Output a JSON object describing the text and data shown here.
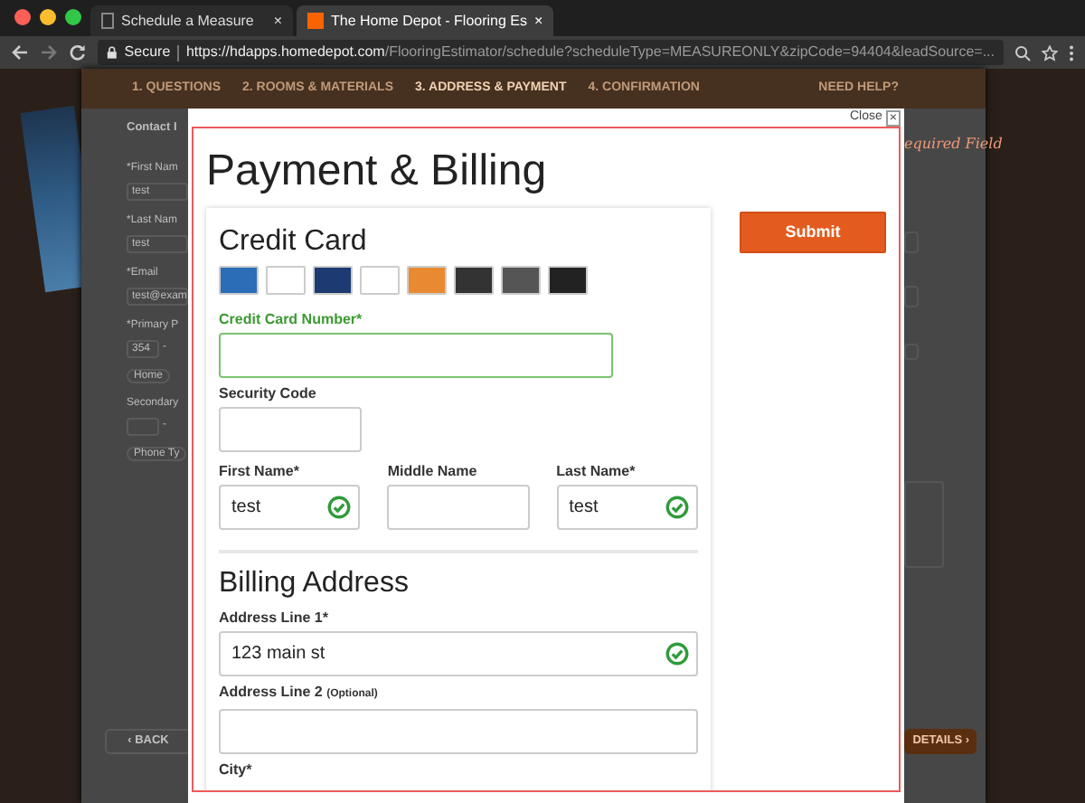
{
  "browser": {
    "tabs": [
      {
        "title": "Schedule a Measure",
        "selected": false
      },
      {
        "title": "The Home Depot - Flooring Es",
        "selected": true
      }
    ],
    "close_glyph": "×",
    "address": {
      "secure": "Secure",
      "host": "https://hdapps.homedepot.com",
      "path": "/FlooringEstimator/schedule?scheduleType=MEASUREONLY&zipCode=94404&leadSource=..."
    }
  },
  "page": {
    "steps": [
      {
        "label": "1. QUESTIONS",
        "selected": false
      },
      {
        "label": "2. ROOMS & MATERIALS",
        "selected": false
      },
      {
        "label": "3. ADDRESS & PAYMENT",
        "selected": true
      },
      {
        "label": "4. CONFIRMATION",
        "selected": false
      }
    ],
    "help": "NEED HELP?",
    "contact_title": "Contact I",
    "contact_items": [
      {
        "kind": "label",
        "text": "*First Nam"
      },
      {
        "kind": "input",
        "text": "test"
      },
      {
        "kind": "label",
        "text": "*Last Nam"
      },
      {
        "kind": "input",
        "text": "test"
      },
      {
        "kind": "label",
        "text": "*Email"
      },
      {
        "kind": "input",
        "text": "test@exam"
      },
      {
        "kind": "label",
        "text": "*Primary P"
      },
      {
        "kind": "phone",
        "text": "354",
        "separator": "-"
      },
      {
        "kind": "select",
        "text": "Home"
      },
      {
        "kind": "label",
        "text": "Secondary"
      },
      {
        "kind": "phone",
        "separator": "-"
      },
      {
        "kind": "select",
        "text": "Phone Ty"
      }
    ],
    "required_note": "equired Field",
    "back_button": "‹ BACK",
    "next_button": "DETAILS ›"
  },
  "modal": {
    "close": "Close",
    "close_glyph": "×",
    "title": "Payment & Billing",
    "submit": "Submit",
    "credit_card": {
      "title": "Credit Card",
      "number": {
        "label": "Credit Card Number*",
        "focused": true
      },
      "security": {
        "label": "Security Code"
      },
      "names": [
        {
          "label": "First Name*",
          "value": "test",
          "valid": true
        },
        {
          "label": "Middle Name",
          "valid": false
        },
        {
          "label": "Last Name*",
          "value": "test",
          "valid": true
        }
      ]
    },
    "billing": {
      "title": "Billing Address",
      "fields": [
        {
          "label": "Address Line 1*",
          "kind": "input",
          "value": "123 main st",
          "valid": true
        },
        {
          "label": "Address Line 2",
          "kind": "input",
          "note": "(Optional)",
          "valid": false
        },
        {
          "label": "City*",
          "kind": "label_only"
        }
      ]
    }
  }
}
